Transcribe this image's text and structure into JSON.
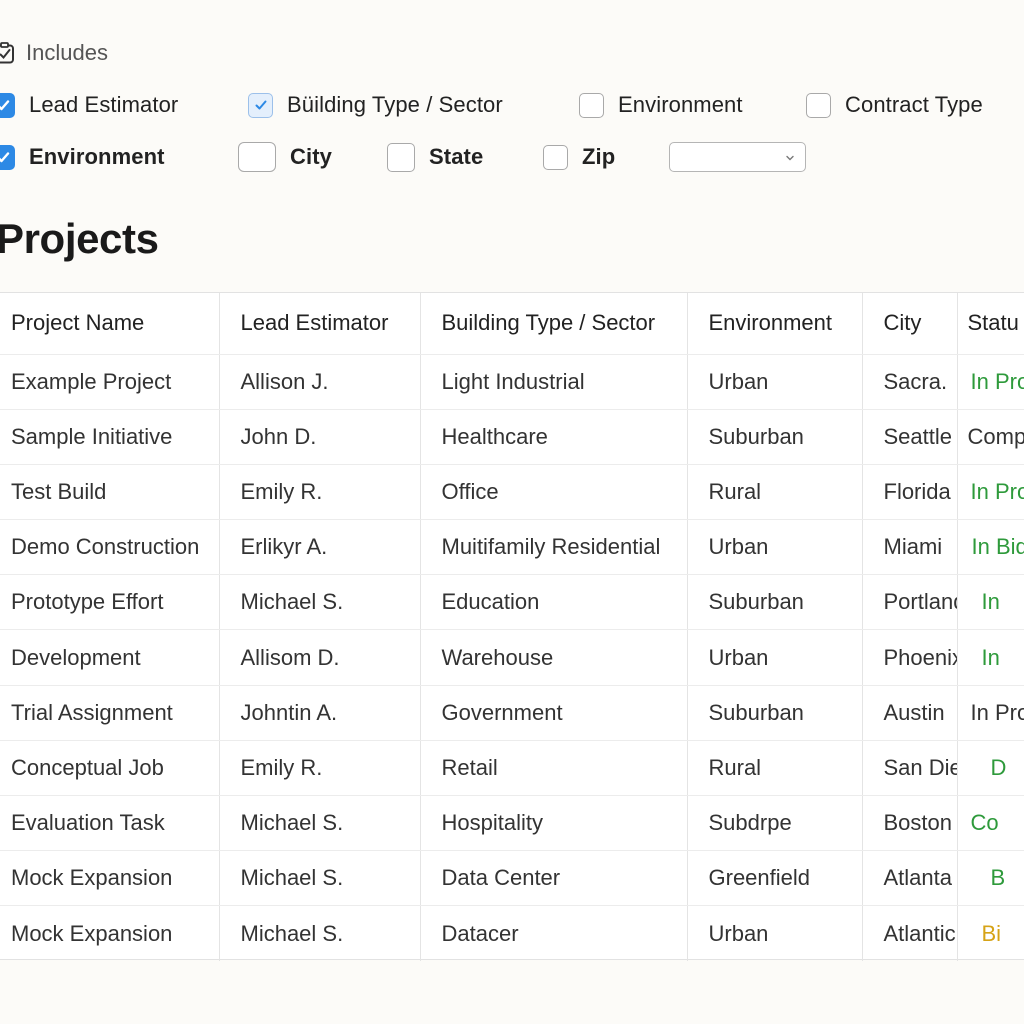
{
  "includes": {
    "label": "Includes",
    "icon": "checklist-icon"
  },
  "filters": {
    "row1": [
      {
        "label": "Lead Estimator",
        "checked": true
      },
      {
        "label": "Büilding Type / Sector",
        "checked": true
      },
      {
        "label": "Environment",
        "checked": false
      },
      {
        "label": "Contract Type",
        "checked": false
      }
    ],
    "row2": [
      {
        "label": "Environment",
        "checked": true
      },
      {
        "label": "City",
        "checked": false
      },
      {
        "label": "State",
        "checked": false
      },
      {
        "label": "Zip",
        "checked": false
      }
    ],
    "select": {
      "value": "",
      "icon": "chevron-down-icon"
    }
  },
  "page": {
    "title": "Projects"
  },
  "table": {
    "columns": [
      "Project Name",
      "Lead Estimator",
      "Building Type / Sector",
      "Environment",
      "City",
      "Statu"
    ],
    "rows": [
      {
        "name": "Example Project",
        "lead": "Allison J.",
        "type": "Light Industrial",
        "env": "Urban",
        "city": "Sacra.",
        "status": "In Pro"
      },
      {
        "name": "Sample Initiative",
        "lead": "John D.",
        "type": "Healthcare",
        "env": "Suburban",
        "city": "Seattle",
        "status": "Comp"
      },
      {
        "name": "Test Build",
        "lead": "Emily R.",
        "type": "Office",
        "env": "Rural",
        "city": "Florida",
        "status": "In Pro"
      },
      {
        "name": "Demo Construction",
        "lead": "Erlikyr A.",
        "type": "Muitifamily Residential",
        "env": "Urban",
        "city": "Miami",
        "status": "In Bid"
      },
      {
        "name": "Prototype Effort",
        "lead": "Michael S.",
        "type": "Education",
        "env": "Suburban",
        "city": "Portland",
        "status": "In"
      },
      {
        "name": "Development",
        "lead": "Allisom D.",
        "type": "Warehouse",
        "env": "Urban",
        "city": "Phoenix",
        "status": "In"
      },
      {
        "name": "Trial Assignment",
        "lead": "Johntin A.",
        "type": "Government",
        "env": "Suburban",
        "city": "Austin",
        "status": "In Pro"
      },
      {
        "name": "Conceptual Job",
        "lead": "Emily R.",
        "type": "Retail",
        "env": "Rural",
        "city": "San Diego",
        "status": "D"
      },
      {
        "name": "Evaluation Task",
        "lead": "Michael S.",
        "type": "Hospitality",
        "env": "Subdrpe",
        "city": "Boston",
        "status": "Co"
      },
      {
        "name": "Mock Expansion",
        "lead": "Michael S.",
        "type": "Data Center",
        "env": "Greenfield",
        "city": "Atlanta",
        "status": "B"
      },
      {
        "name": "Mock Expansion",
        "lead": "Michael S.",
        "type": "Datacer",
        "env": "Urban",
        "city": "Atlantic",
        "status": "Bi"
      }
    ]
  },
  "colors": {
    "checkbox_accent": "#2d89e5",
    "status_green": "#2e9a3b",
    "status_amber": "#d6a317",
    "status_neutral": "#333333"
  }
}
